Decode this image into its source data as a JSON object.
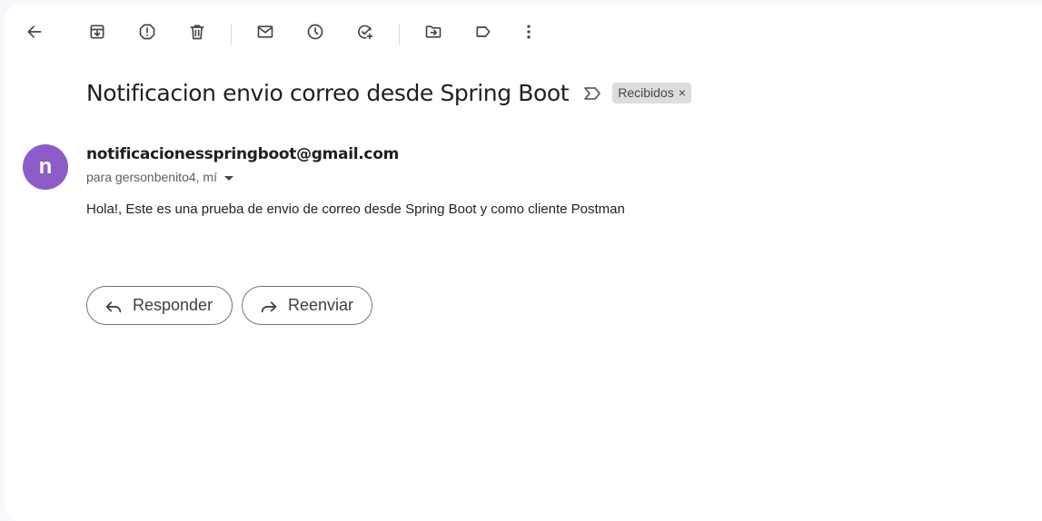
{
  "toolbar": {
    "icons": [
      "back-arrow-icon",
      "archive-icon",
      "report-spam-icon",
      "delete-icon",
      "mark-unread-icon",
      "snooze-icon",
      "add-task-icon",
      "move-to-icon",
      "label-icon",
      "more-options-icon"
    ]
  },
  "message": {
    "subject": "Notificacion envio correo desde Spring Boot",
    "label_chip": "Recibidos",
    "label_chip_close": "×",
    "sender_initial": "n",
    "sender_email": "notificacionesspringboot@gmail.com",
    "recipients": "para gersonbenito4, mí",
    "body": "Hola!, Este es una prueba de envio de correo desde Spring Boot y como cliente Postman"
  },
  "actions": {
    "reply_label": "Responder",
    "forward_label": "Reenviar"
  },
  "colors": {
    "avatar_bg": "#8d5cc8",
    "page_bg": "#f6f8fc",
    "panel_bg": "#ffffff",
    "chip_bg": "#dddddd"
  }
}
